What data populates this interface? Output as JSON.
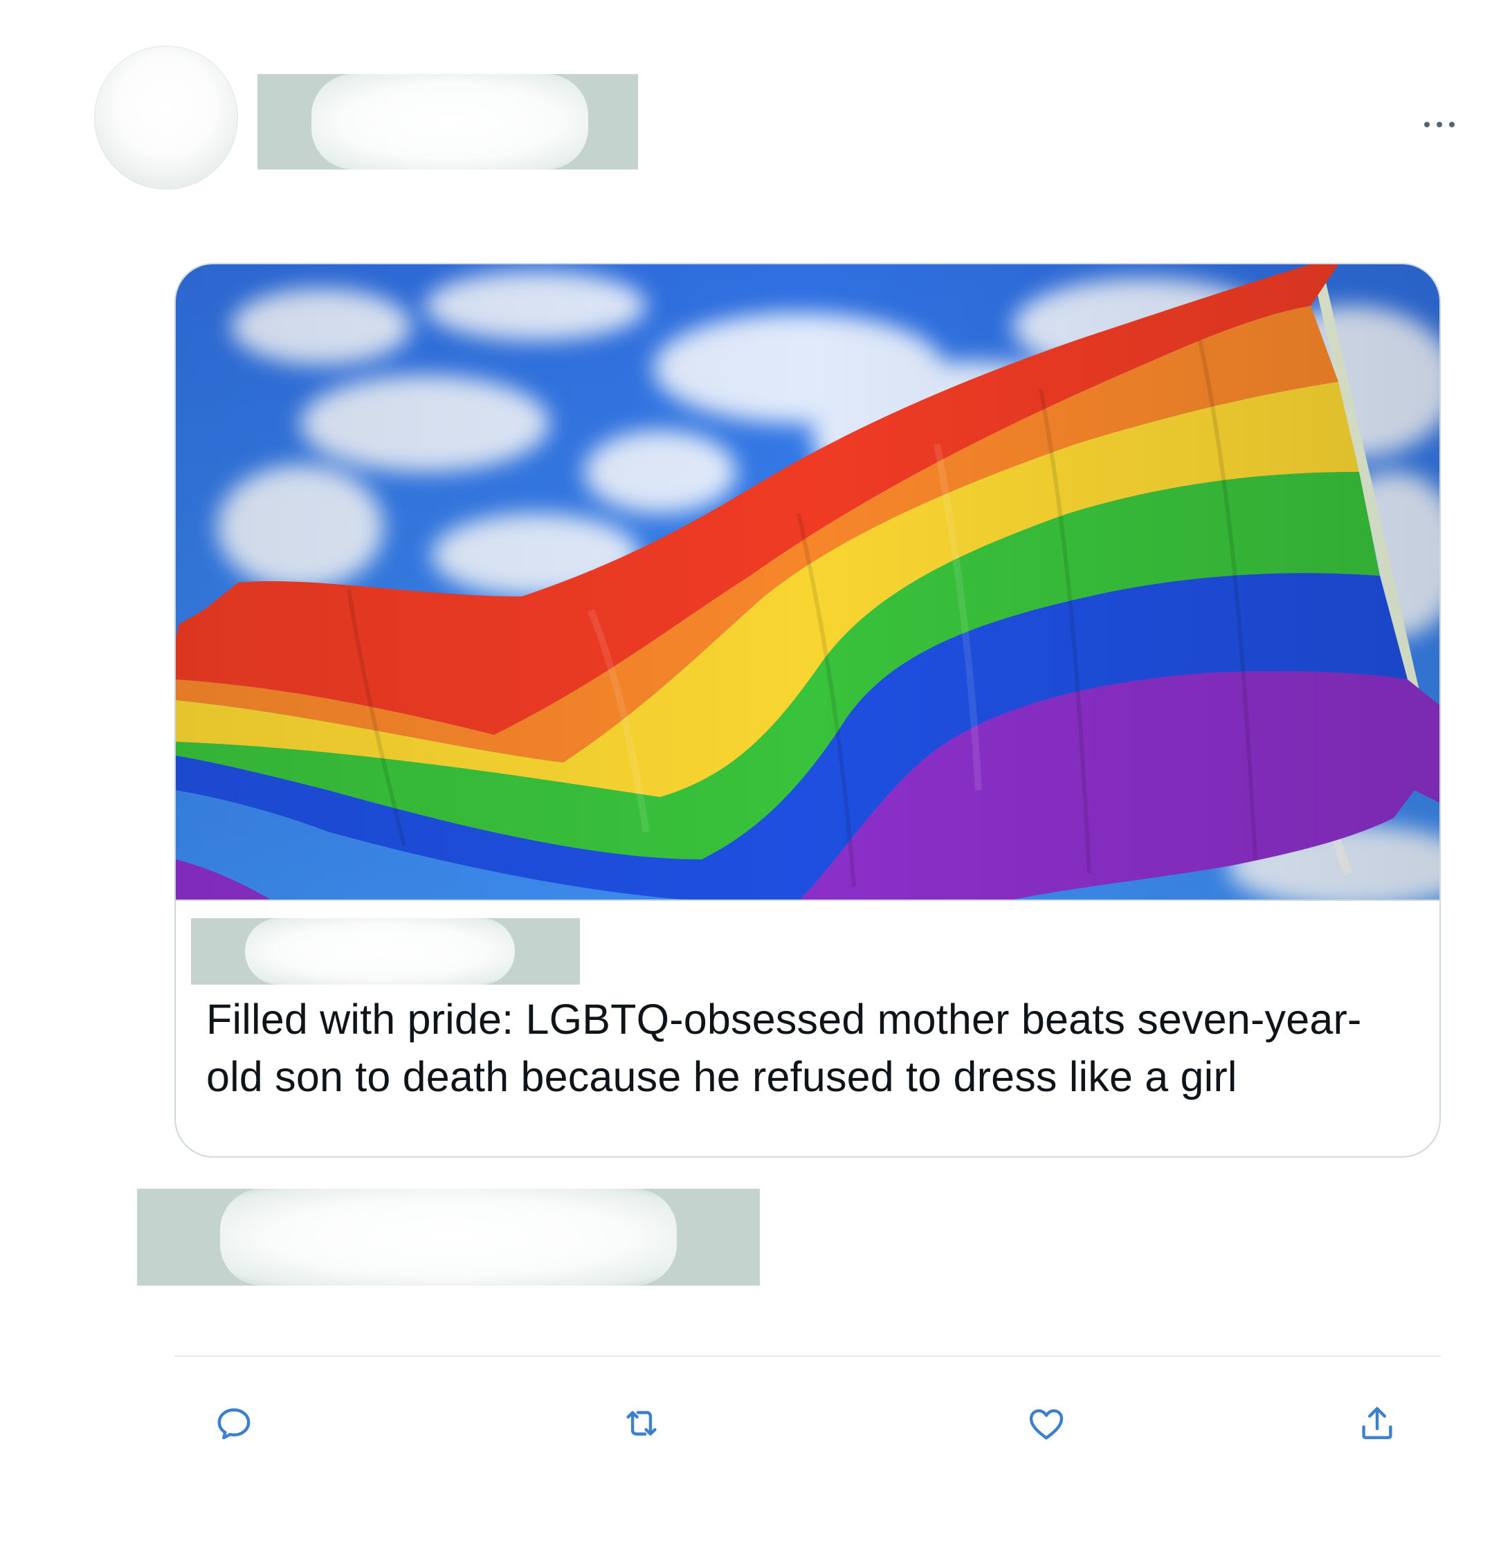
{
  "tweet": {
    "author": {
      "avatar_redacted": true,
      "name_redacted": true
    },
    "more_menu_icon": "more-horizontal-icon",
    "link_card": {
      "image": {
        "subject": "rainbow pride flag waving against blue sky with clouds",
        "stripe_colors": [
          "#ef3b24",
          "#f7862a",
          "#f9d531",
          "#39c23b",
          "#1e4fe0",
          "#8b2fc9"
        ],
        "sky_color": "#2f78e6"
      },
      "domain_redacted": true,
      "title": "Filled with pride: LGBTQ-obsessed mother beats seven-year-old son to death because he refused to dress like a girl"
    },
    "meta_redacted": true,
    "actions": [
      {
        "name": "reply",
        "icon": "reply-icon"
      },
      {
        "name": "retweet",
        "icon": "retweet-icon"
      },
      {
        "name": "like",
        "icon": "heart-icon"
      },
      {
        "name": "share",
        "icon": "share-icon"
      }
    ],
    "colors": {
      "icon": "#3b7fcf",
      "border": "#cfd9de",
      "redaction": "#c5d3cf",
      "text": "#0f1419"
    }
  }
}
